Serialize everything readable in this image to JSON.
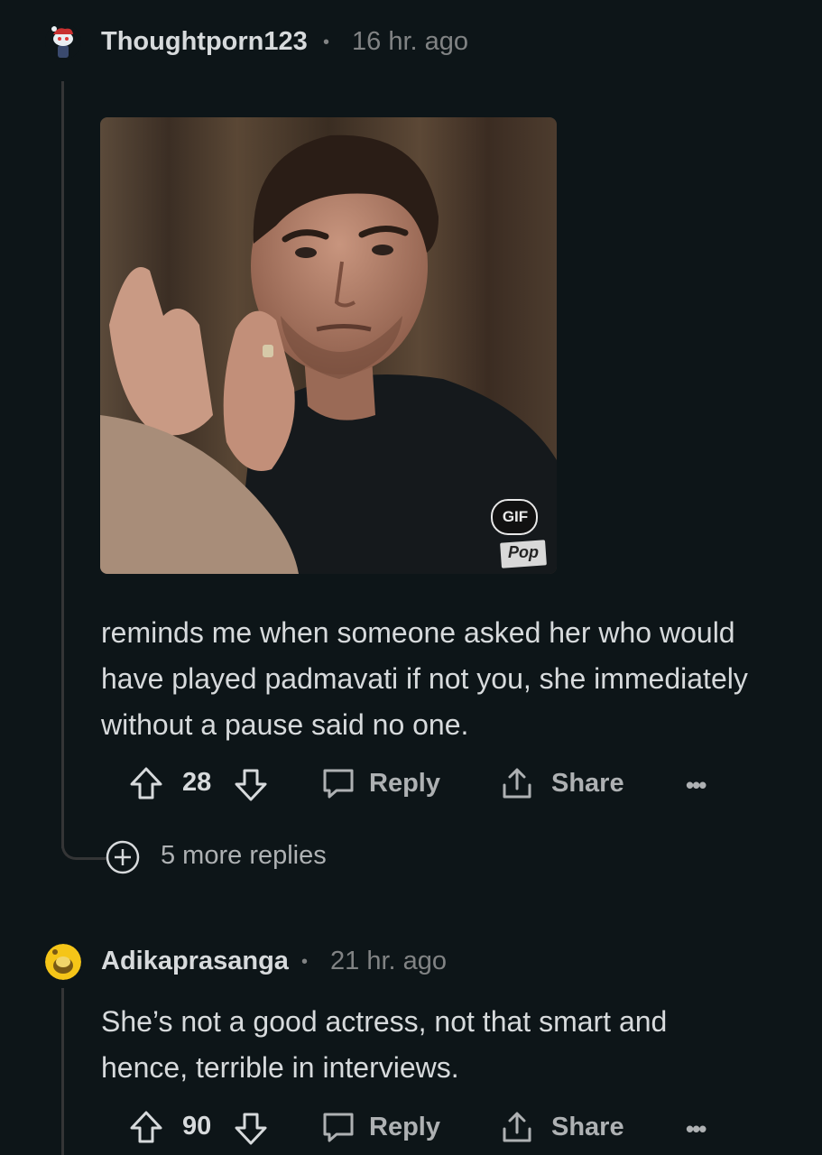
{
  "comments": [
    {
      "username": "Thoughtporn123",
      "separator": "•",
      "time": "16 hr. ago",
      "media": {
        "badge": "GIF",
        "watermark": "Pop"
      },
      "text": "reminds me when someone asked her who would have played padmavati if not you, she immediately without a pause said no one.",
      "votes": "28",
      "reply_label": "Reply",
      "share_label": "Share",
      "more_label": "•••",
      "more_replies": "5 more replies"
    },
    {
      "username": "Adikaprasanga",
      "separator": "•",
      "time": "21 hr. ago",
      "text": "She’s not a good actress, not that smart and hence, terrible in interviews.",
      "votes": "90",
      "reply_label": "Reply",
      "share_label": "Share",
      "more_label": "•••"
    }
  ],
  "colors": {
    "background": "#0d1518",
    "text": "#d7dadc",
    "muted": "#818384"
  },
  "icons": [
    "snoo-avatar-icon",
    "upvote-icon",
    "downvote-icon",
    "comment-icon",
    "share-icon",
    "more-icon",
    "expand-plus-icon",
    "gif-badge-icon"
  ]
}
